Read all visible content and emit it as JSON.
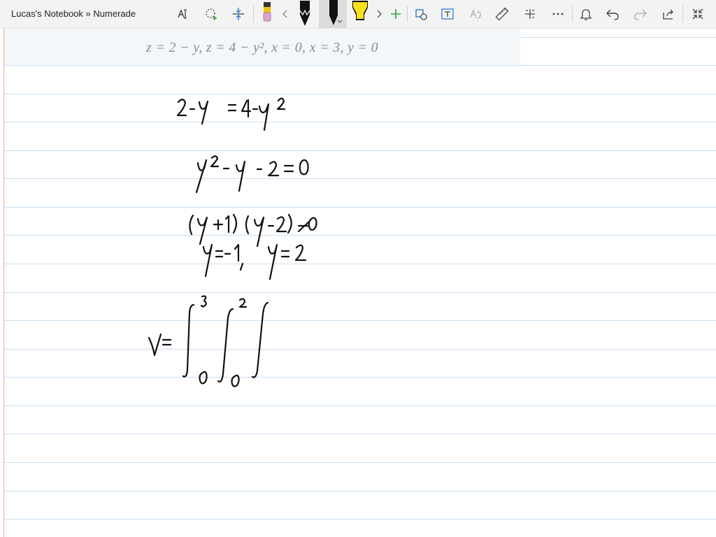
{
  "window": {
    "title": "Lucas's Notebook » Numerade"
  },
  "toolbar": {
    "icons": [
      "lasso-select-icon",
      "add-shape-icon",
      "insert-space-icon",
      "pen-pink-icon",
      "chevron-left-icon",
      "pencil-icon",
      "pen-black-icon",
      "highlighter-yellow-icon",
      "chevron-right-icon",
      "add-pen-icon",
      "ink-to-shape-icon",
      "ink-to-text-icon",
      "ink-to-math-icon",
      "ruler-icon",
      "math-icon",
      "more-icon",
      "bell-icon",
      "undo-icon",
      "redo-icon",
      "share-icon",
      "fullscreen-collapse-icon"
    ],
    "colors": {
      "pink_pen": "#e4a3d3",
      "highlighter": "#f8e11a",
      "accent_blue": "#2b7cd3",
      "accent_green": "#2e9e3e"
    }
  },
  "problem": {
    "statement": "z = 2 − y, z = 4 − y², x = 0, x = 3, y = 0"
  },
  "handwriting": {
    "ink_color": "#111111",
    "lines": [
      "2 - y = 4 - y²",
      "y² - y - 2 = 0",
      "(y+1)(y-2) = 0",
      "y = -1, y = 2",
      "V = ∫₀³ ∫₀² ∫"
    ]
  }
}
